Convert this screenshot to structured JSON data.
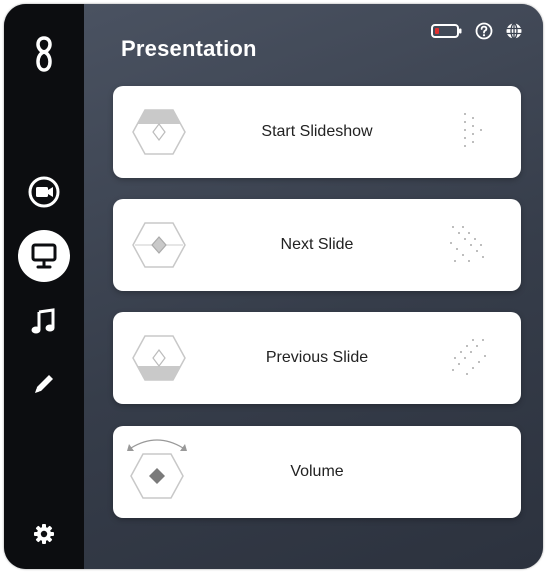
{
  "window": {
    "title": "Presentation"
  },
  "sidebar": {
    "items": [
      {
        "name": "logo-icon"
      },
      {
        "name": "video-icon"
      },
      {
        "name": "presentation-icon",
        "active": true
      },
      {
        "name": "music-icon"
      },
      {
        "name": "pen-icon"
      },
      {
        "name": "settings-icon"
      }
    ]
  },
  "header": {
    "icons": [
      "battery-icon",
      "help-icon",
      "globe-icon"
    ]
  },
  "cards": [
    {
      "label": "Start Slideshow",
      "icon": "hexagon-button-top-icon",
      "gesture": "dots-vertical-icon"
    },
    {
      "label": "Next Slide",
      "icon": "hexagon-button-center-icon",
      "gesture": "dots-diagonal-down-icon"
    },
    {
      "label": "Previous Slide",
      "icon": "hexagon-button-bottom-icon",
      "gesture": "dots-diagonal-up-icon"
    },
    {
      "label": "Volume",
      "icon": "hexagon-rotate-icon",
      "gesture": ""
    }
  ],
  "colors": {
    "sidebar": "#0c0d10",
    "main_top": "#4a5261",
    "main_bottom": "#2c323e",
    "card": "#ffffff",
    "battery_accent": "#e03030"
  }
}
